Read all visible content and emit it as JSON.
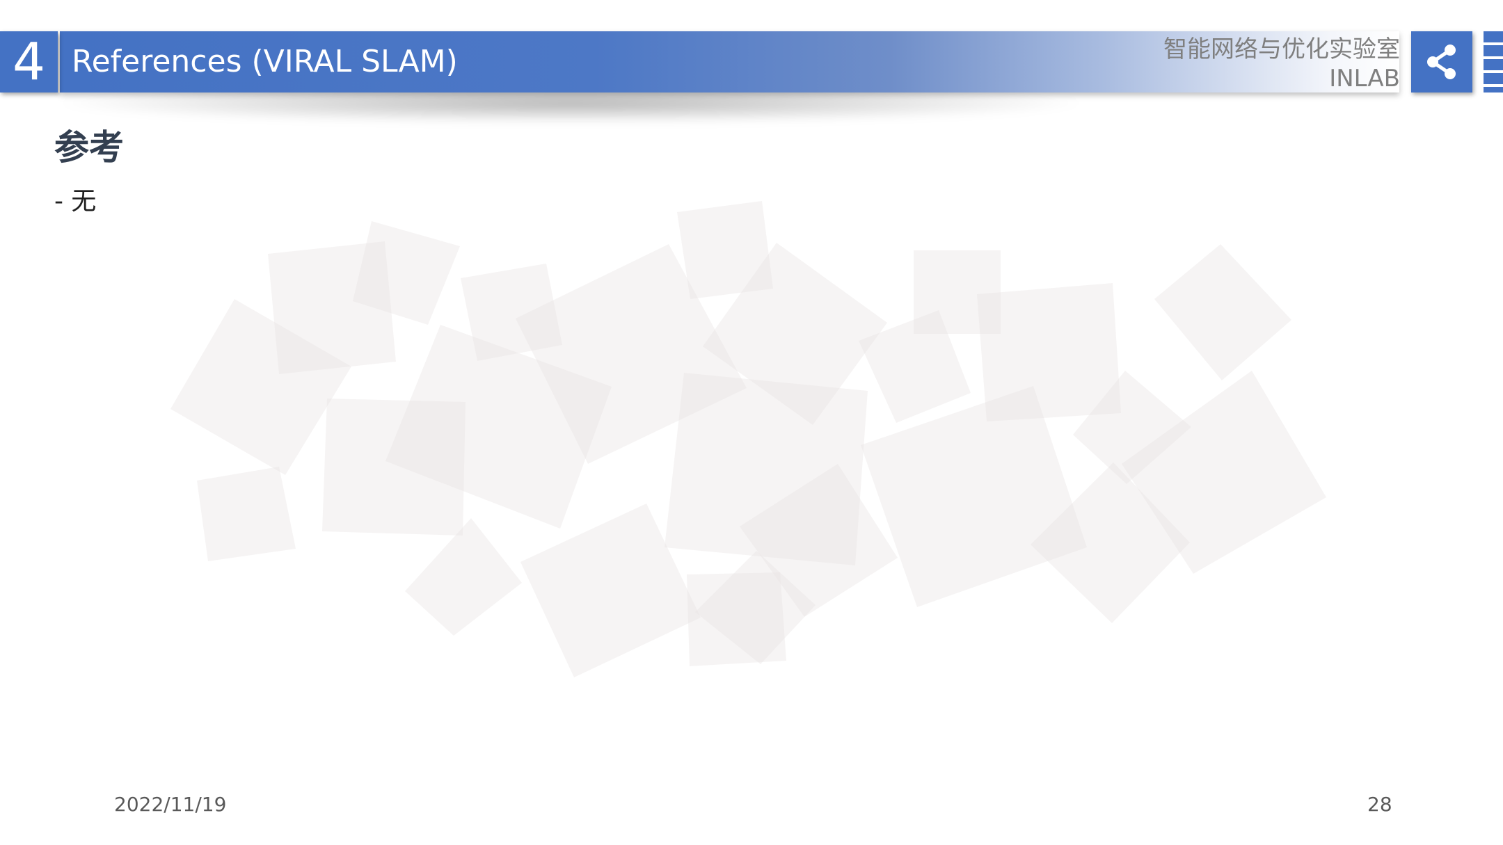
{
  "header": {
    "section_number": "4",
    "title": "References (VIRAL SLAM)",
    "lab_name_cn": "智能网络与优化实验室",
    "lab_name_en": "INLAB"
  },
  "content": {
    "heading": "参考",
    "bullet": "- 无"
  },
  "footer": {
    "date": "2022/11/19",
    "page_number": "28"
  },
  "colors": {
    "accent": "#4472c4",
    "decor": "#efe9e9"
  },
  "icons": {
    "share": "share-icon"
  }
}
